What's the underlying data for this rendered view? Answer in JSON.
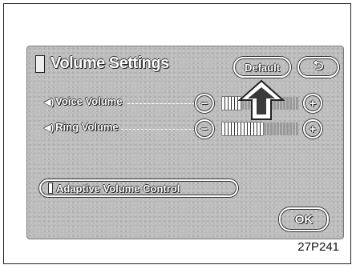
{
  "header": {
    "title": "Volume Settings",
    "default_label": "Default",
    "back_label": "⮌"
  },
  "rows": [
    {
      "label": "Voice Volume",
      "minus": "−",
      "plus": "+",
      "level": 0.25
    },
    {
      "label": "Ring Volume",
      "minus": "−",
      "plus": "+",
      "level": 0.55
    }
  ],
  "avc": {
    "label": "Adaptive Volume Control"
  },
  "ok_label": "OK",
  "caption": "27P241",
  "icons": {
    "speaker": "◀)",
    "title": "page-icon"
  }
}
